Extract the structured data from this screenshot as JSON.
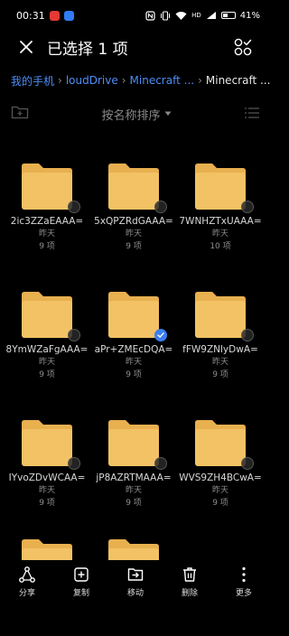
{
  "status": {
    "time": "00:31",
    "signal_text": "HD",
    "battery": "41%",
    "app_badge_colors": [
      "#e53935",
      "#2f7cf6"
    ]
  },
  "header": {
    "title": "已选择 1 项"
  },
  "breadcrumb": [
    "我的手机",
    "loudDrive",
    "Minecraft ...",
    "Minecraft ..."
  ],
  "toolbar": {
    "sort_label": "按名称排序"
  },
  "folders": [
    {
      "name": "2ic3ZZaEAAA=",
      "date": "昨天",
      "count": "9 项",
      "checked": false
    },
    {
      "name": "5xQPZRdGAAA=",
      "date": "昨天",
      "count": "9 项",
      "checked": false
    },
    {
      "name": "7WNHZTxUAAA=",
      "date": "昨天",
      "count": "10 项",
      "checked": false
    },
    {
      "name": "8YmWZaFgAAA=",
      "date": "昨天",
      "count": "9 项",
      "checked": false
    },
    {
      "name": "aPr+ZMEcDQA=",
      "date": "昨天",
      "count": "9 项",
      "checked": true
    },
    {
      "name": "fFW9ZNlyDwA=",
      "date": "昨天",
      "count": "9 项",
      "checked": false
    },
    {
      "name": "IYvoZDvWCAA=",
      "date": "昨天",
      "count": "9 项",
      "checked": false
    },
    {
      "name": "jP8AZRTMAAA=",
      "date": "昨天",
      "count": "9 项",
      "checked": false
    },
    {
      "name": "WVS9ZH4BCwA=",
      "date": "昨天",
      "count": "9 项",
      "checked": false
    }
  ],
  "bottom_actions": [
    {
      "label": "分享",
      "icon": "share-icon"
    },
    {
      "label": "复制",
      "icon": "copy-icon"
    },
    {
      "label": "移动",
      "icon": "move-icon"
    },
    {
      "label": "删除",
      "icon": "delete-icon"
    },
    {
      "label": "更多",
      "icon": "more-icon"
    }
  ],
  "colors": {
    "accent": "#3b7ef0",
    "link": "#4d8ef7",
    "folder": "#f2c265",
    "folder_tab": "#e8b04f"
  }
}
